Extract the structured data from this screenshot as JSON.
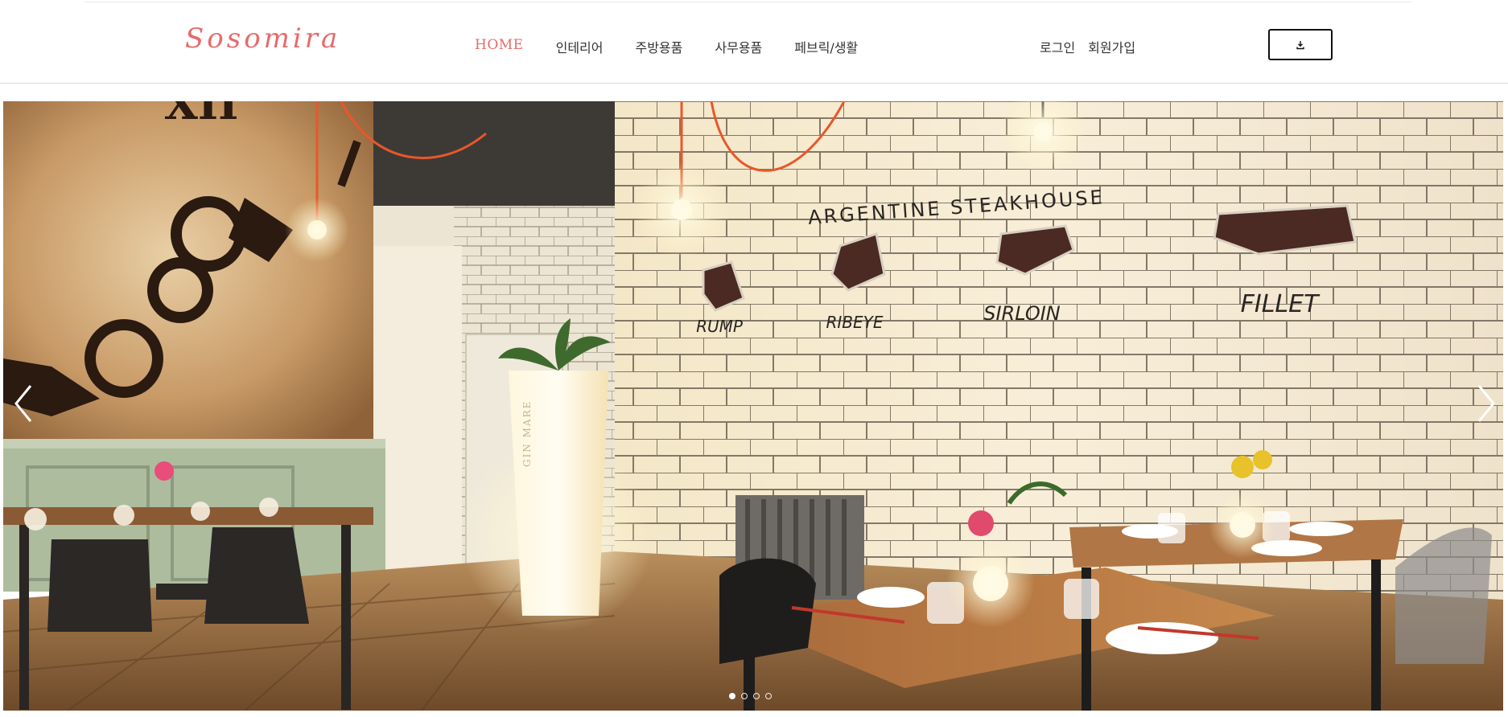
{
  "brand": {
    "logo_text": "Sosomira",
    "accent": "#e86a6a"
  },
  "nav": {
    "items": [
      {
        "label": "HOME",
        "active": true
      },
      {
        "label": "인테리어",
        "active": false
      },
      {
        "label": "주방용품",
        "active": false
      },
      {
        "label": "사무용품",
        "active": false
      },
      {
        "label": "페브릭/생활",
        "active": false
      }
    ]
  },
  "user_nav": {
    "login": "로그인",
    "signup": "회원가입"
  },
  "download_button": {
    "icon": "download-icon"
  },
  "hero": {
    "wall_sign": "ARGENTINE STEAKHOUSE",
    "cuts": [
      "RUMP",
      "RIBEYE",
      "SIRLOIN",
      "FILLET"
    ],
    "planter_text": "GIN MARE",
    "prev_icon": "chevron-left-icon",
    "next_icon": "chevron-right-icon",
    "slide_count": 4,
    "active_slide": 1
  }
}
